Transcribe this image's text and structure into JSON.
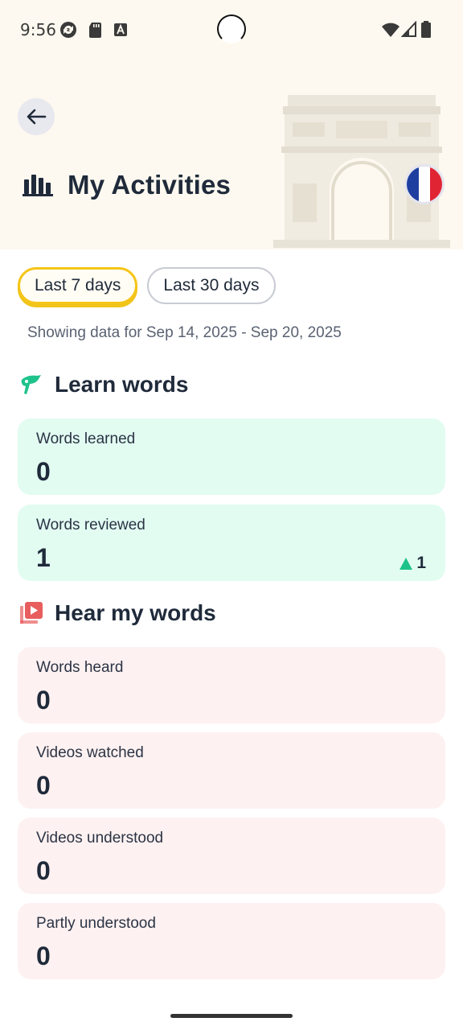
{
  "status_bar": {
    "time": "9:56"
  },
  "header": {
    "back_icon": "arrow-left-icon",
    "title_icon": "bar-chart-icon",
    "title": "My Activities",
    "language_flag": "france-flag",
    "flag_colors": [
      "#1f3fa0",
      "#ffffff",
      "#e02434"
    ]
  },
  "range_tabs": [
    {
      "label": "Last 7 days",
      "selected": true
    },
    {
      "label": "Last 30 days",
      "selected": false
    }
  ],
  "range_info": "Showing data for Sep 14, 2025 - Sep 20, 2025",
  "sections": {
    "learn_words": {
      "title": "Learn words",
      "icon": "pointing-hand-icon",
      "accent": "#1ec38b",
      "stats": [
        {
          "label": "Words learned",
          "value": "0"
        },
        {
          "label": "Words reviewed",
          "value": "1",
          "delta": "1"
        }
      ]
    },
    "hear_words": {
      "title": "Hear my words",
      "icon": "video-library-icon",
      "accent": "#e85d5d",
      "stats": [
        {
          "label": "Words heard",
          "value": "0"
        },
        {
          "label": "Videos watched",
          "value": "0"
        },
        {
          "label": "Videos understood",
          "value": "0"
        },
        {
          "label": "Partly understood",
          "value": "0"
        }
      ]
    }
  }
}
